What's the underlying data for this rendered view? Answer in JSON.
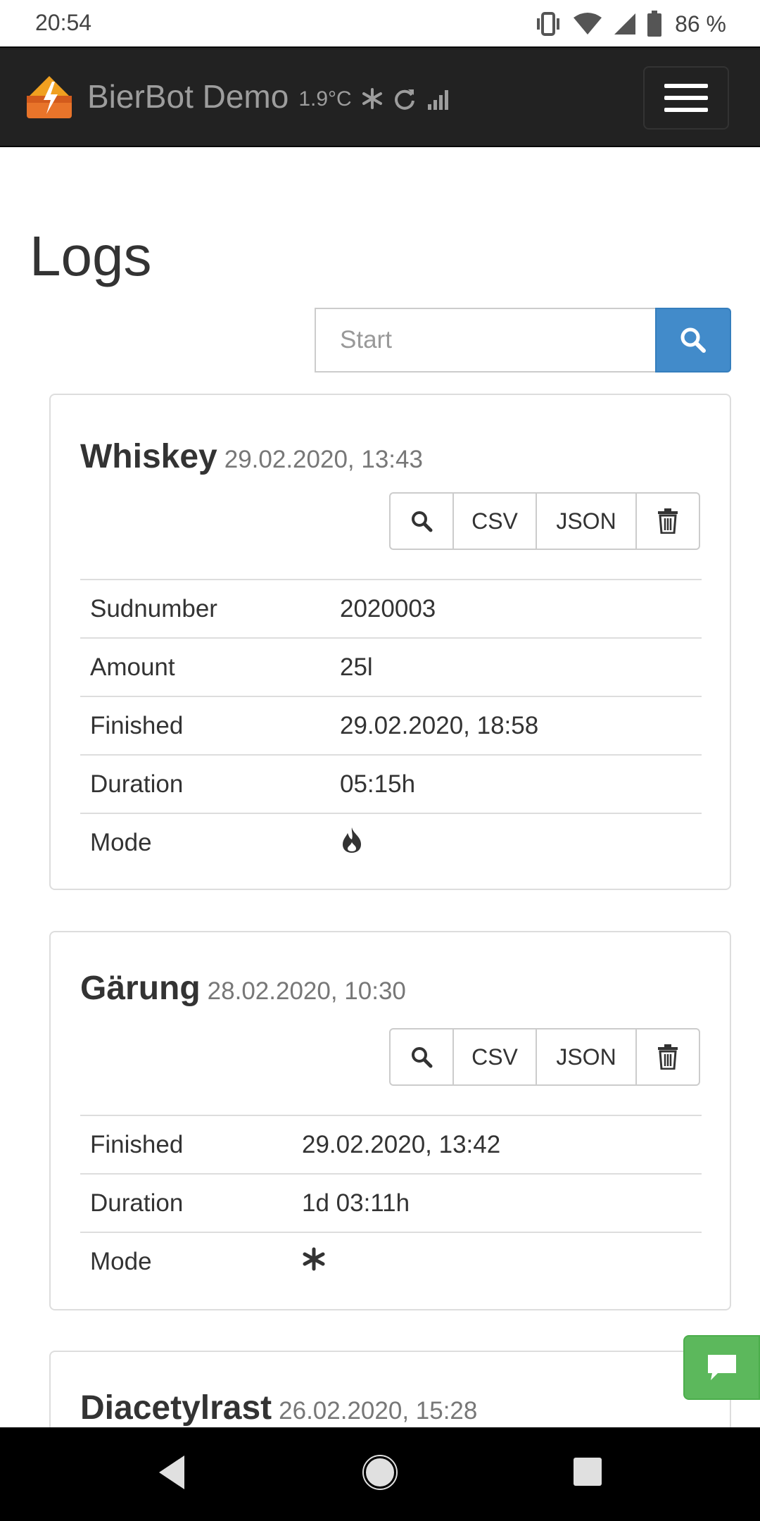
{
  "status_bar": {
    "time": "20:54",
    "battery": "86 %",
    "icons": [
      "vibrate-icon",
      "wifi-icon",
      "signal-icon",
      "battery-icon"
    ]
  },
  "header": {
    "brand": "BierBot Demo",
    "temperature": "1.9°C",
    "icons": [
      "logo-icon",
      "snowflake-icon",
      "refresh-icon",
      "signal-bars-icon",
      "menu-icon"
    ],
    "colors": {
      "bar": "#222222",
      "text": "#9d9d9d"
    }
  },
  "page": {
    "title": "Logs"
  },
  "search": {
    "placeholder": "Start",
    "button_color": "#428bca"
  },
  "logs": [
    {
      "name": "Whiskey",
      "date": "29.02.2020, 13:43",
      "actions": {
        "csv": "CSV",
        "json": "JSON"
      },
      "rows": [
        {
          "label": "Sudnumber",
          "value": "2020003"
        },
        {
          "label": "Amount",
          "value": "25l"
        },
        {
          "label": "Finished",
          "value": "29.02.2020, 18:58"
        },
        {
          "label": "Duration",
          "value": "05:15h"
        },
        {
          "label": "Mode",
          "icon": "fire-icon"
        }
      ]
    },
    {
      "name": "Gärung",
      "date": "28.02.2020, 10:30",
      "actions": {
        "csv": "CSV",
        "json": "JSON"
      },
      "rows": [
        {
          "label": "Finished",
          "value": "29.02.2020, 13:42"
        },
        {
          "label": "Duration",
          "value": "1d 03:11h"
        },
        {
          "label": "Mode",
          "icon": "snowflake-icon"
        }
      ]
    },
    {
      "name": "Diacetylrast",
      "date": "26.02.2020, 15:28"
    }
  ],
  "chat_button_color": "#5cb85c"
}
